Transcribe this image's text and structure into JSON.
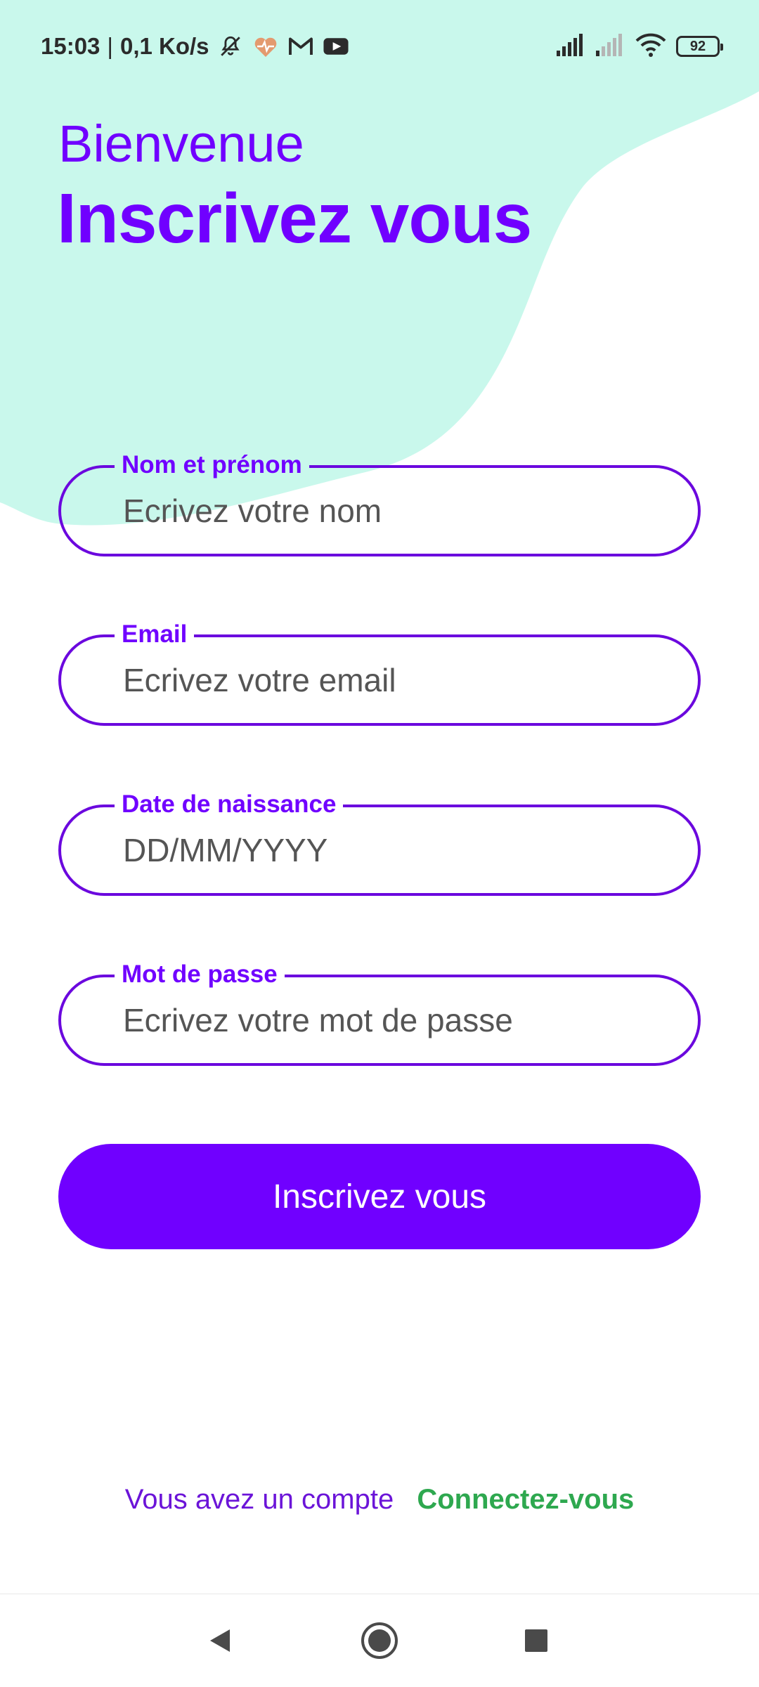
{
  "status_bar": {
    "time": "15:03",
    "separator": "|",
    "network_speed": "0,1 Ko/s",
    "left_icons": [
      "bell-off-icon",
      "heart-rate-icon",
      "gmail-icon",
      "youtube-icon"
    ],
    "right_icons": [
      "signal-icon",
      "signal-weak-icon",
      "wifi-icon"
    ],
    "battery_level": "92"
  },
  "header": {
    "greeting": "Bienvenue",
    "title": "Inscrivez vous"
  },
  "form": {
    "name": {
      "label": "Nom et prénom",
      "placeholder": "Ecrivez votre nom"
    },
    "email": {
      "label": "Email",
      "placeholder": "Ecrivez votre email"
    },
    "birthdate": {
      "label": "Date de naissance",
      "placeholder": "DD/MM/YYYY"
    },
    "password": {
      "label": "Mot de passe",
      "placeholder": "Ecrivez votre mot de passe"
    },
    "submit_label": "Inscrivez vous"
  },
  "footer": {
    "prompt": "Vous avez un compte",
    "link": "Connectez-vous"
  },
  "nav": [
    "back-icon",
    "home-icon",
    "recents-icon"
  ],
  "colors": {
    "primary": "#7000ff",
    "field_border": "#6b08de",
    "mint_background": "#c9f8ec",
    "link_green": "#2ea84f",
    "placeholder_gray": "#555555"
  }
}
